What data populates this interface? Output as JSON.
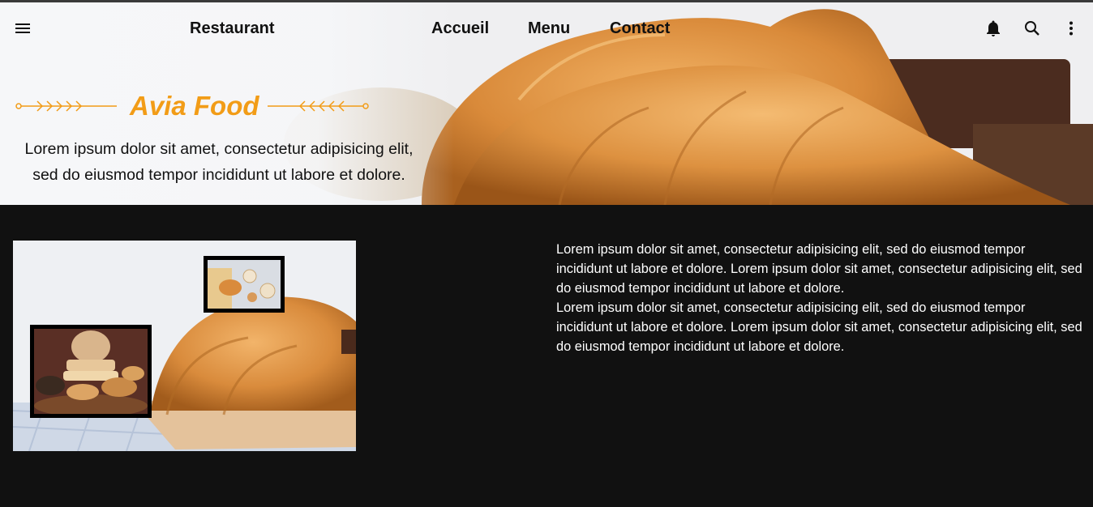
{
  "nav": {
    "brand_label": "Restaurant",
    "links": [
      "Accueil",
      "Menu",
      "Contact"
    ],
    "icons": [
      "menu-icon",
      "bell-icon",
      "search-icon",
      "more-vert-icon"
    ]
  },
  "hero": {
    "title": "Avia Food",
    "subtitle_line1": "Lorem ipsum dolor sit amet, consectetur adipisicing elit,",
    "subtitle_line2": "sed do eiusmod tempor incididunt ut labore et dolore."
  },
  "content": {
    "paragraph1": "Lorem ipsum dolor sit amet, consectetur adipisicing elit, sed do eiusmod tempor incididunt ut labore et dolore. Lorem ipsum dolor sit amet, consectetur adipisicing elit, sed do eiusmod tempor incididunt ut labore et dolore.",
    "paragraph2": "Lorem ipsum dolor sit amet, consectetur adipisicing elit, sed do eiusmod tempor incididunt ut labore et dolore. Lorem ipsum dolor sit amet, consectetur adipisicing elit, sed do eiusmod tempor incididunt ut labore et dolore."
  },
  "colors": {
    "accent": "#f29c17",
    "background_dark": "#111111",
    "text_light": "#ffffff"
  }
}
